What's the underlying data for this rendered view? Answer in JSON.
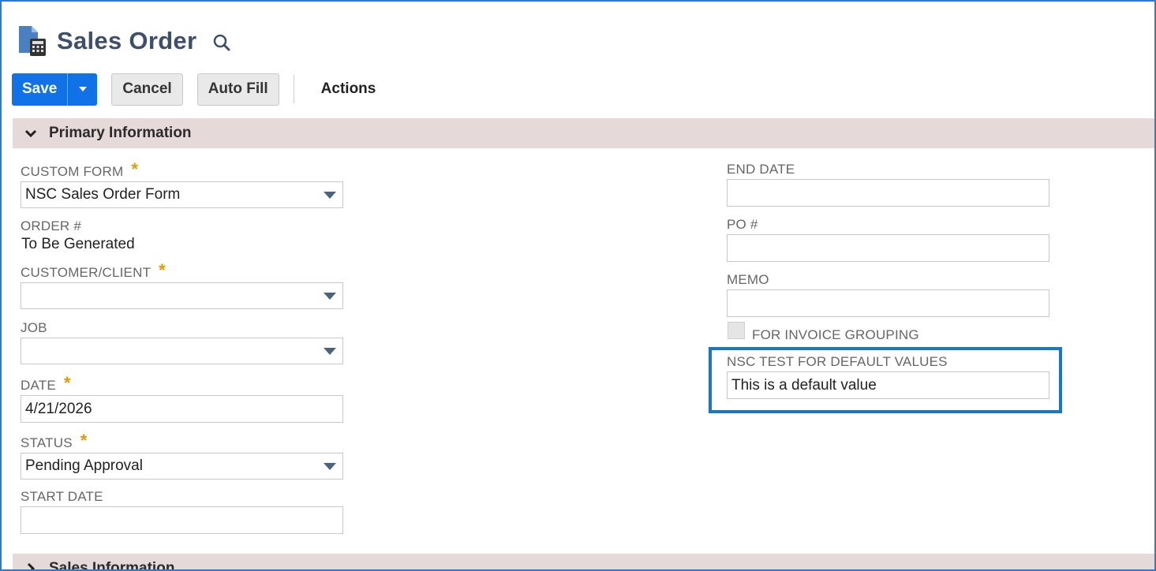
{
  "header": {
    "title": "Sales Order",
    "icon": "document-calculator-icon"
  },
  "toolbar": {
    "save_label": "Save",
    "cancel_label": "Cancel",
    "autofill_label": "Auto Fill",
    "actions_label": "Actions"
  },
  "sections": {
    "primary": "Primary Information",
    "sales": "Sales Information"
  },
  "left_fields": {
    "custom_form": {
      "label": "CUSTOM FORM",
      "value": "NSC Sales Order Form",
      "required": "*"
    },
    "order": {
      "label": "ORDER #",
      "value": "To Be Generated"
    },
    "customer": {
      "label": "CUSTOMER/CLIENT",
      "value": "",
      "required": "*"
    },
    "job": {
      "label": "JOB",
      "value": ""
    },
    "date": {
      "label": "DATE",
      "value": "4/21/2026",
      "required": "*"
    },
    "status": {
      "label": "STATUS",
      "value": "Pending Approval",
      "required": "*"
    },
    "start_date": {
      "label": "START DATE",
      "value": ""
    }
  },
  "right_fields": {
    "end_date": {
      "label": "END DATE",
      "value": ""
    },
    "po": {
      "label": "PO #",
      "value": ""
    },
    "memo": {
      "label": "MEMO",
      "value": ""
    },
    "invoice_grouping": {
      "label": "FOR INVOICE GROUPING",
      "checked": false
    },
    "nsc_test": {
      "label": "NSC TEST FOR DEFAULT VALUES",
      "value": "This is a default value"
    }
  },
  "colors": {
    "accent": "#1171e6",
    "section_bg": "#e6d9d9",
    "required": "#e49a00",
    "highlight_border": "#1a78c2",
    "title": "#3d4f6b"
  }
}
